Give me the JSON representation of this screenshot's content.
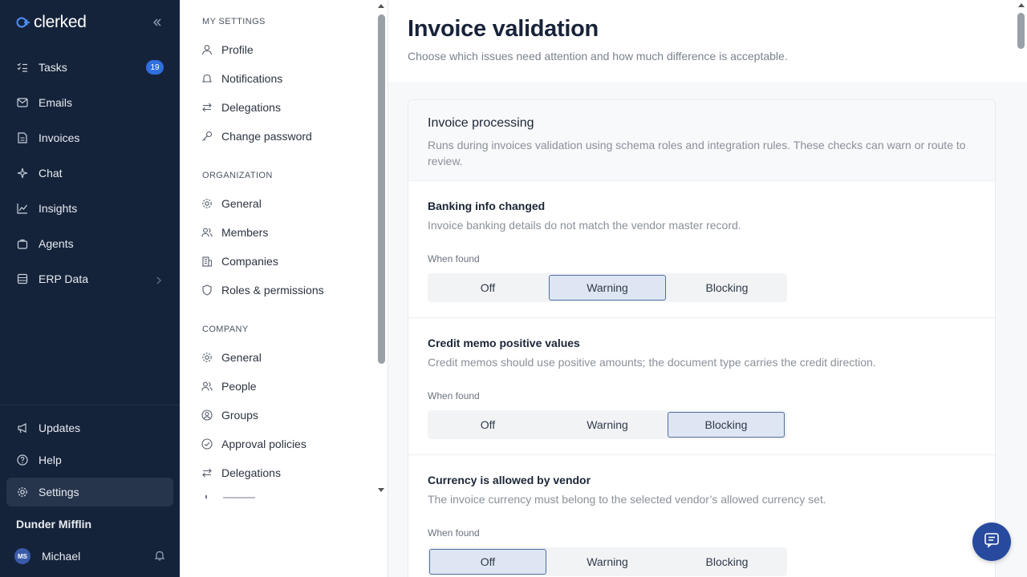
{
  "app": {
    "brand": "clerked"
  },
  "nav": {
    "items": [
      {
        "label": "Tasks",
        "badge": "19"
      },
      {
        "label": "Emails"
      },
      {
        "label": "Invoices"
      },
      {
        "label": "Chat"
      },
      {
        "label": "Insights"
      },
      {
        "label": "Agents"
      },
      {
        "label": "ERP Data"
      }
    ],
    "bottom": [
      {
        "label": "Updates"
      },
      {
        "label": "Help"
      },
      {
        "label": "Settings"
      }
    ],
    "org": "Dunder Mifflin",
    "user": {
      "initials": "MS",
      "name": "Michael"
    }
  },
  "subnav": {
    "sections": [
      {
        "title": "MY SETTINGS",
        "items": [
          "Profile",
          "Notifications",
          "Delegations",
          "Change password"
        ]
      },
      {
        "title": "ORGANIZATION",
        "items": [
          "General",
          "Members",
          "Companies",
          "Roles & permissions"
        ]
      },
      {
        "title": "COMPANY",
        "items": [
          "General",
          "People",
          "Groups",
          "Approval policies",
          "Delegations"
        ]
      }
    ]
  },
  "page": {
    "title": "Invoice validation",
    "subtitle": "Choose which issues need attention and how much difference is acceptable."
  },
  "card": {
    "title": "Invoice processing",
    "description": "Runs during invoices validation using schema roles and integration rules. These checks can warn or route to review.",
    "when_label": "When found",
    "options": [
      "Off",
      "Warning",
      "Blocking"
    ],
    "rules": [
      {
        "title": "Banking info changed",
        "description": "Invoice banking details do not match the vendor master record.",
        "selected": "Warning"
      },
      {
        "title": "Credit memo positive values",
        "description": "Credit memos should use positive amounts; the document type carries the credit direction.",
        "selected": "Blocking"
      },
      {
        "title": "Currency is allowed by vendor",
        "description": "The invoice currency must belong to the selected vendor’s allowed currency set.",
        "selected": "Off"
      }
    ]
  },
  "colors": {
    "sidebar": "#15233a",
    "accent": "#2f6fe0",
    "selected_border": "#4f6ea0",
    "fab": "#274a9e"
  }
}
